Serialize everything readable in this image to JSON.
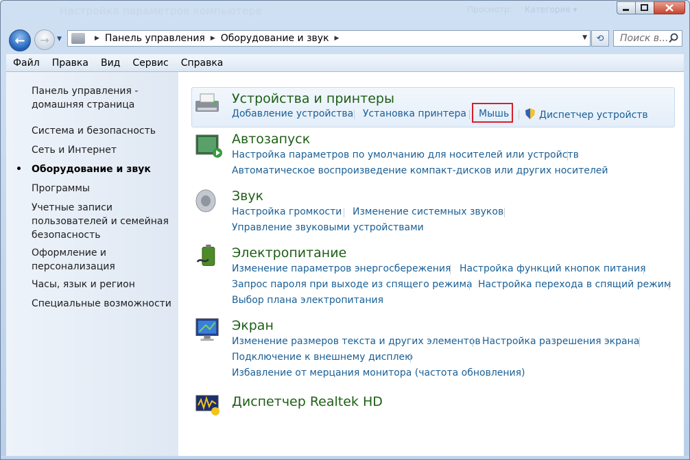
{
  "window": {
    "title": "Настройка параметров компьютера",
    "title_right_1": "Просмотр:",
    "title_right_2": "Категория ▾",
    "minimize_icon": "minimize-icon",
    "maximize_icon": "maximize-icon",
    "close_icon": "close-icon"
  },
  "nav": {
    "back_glyph": "←",
    "forward_glyph": "→",
    "breadcrumb": [
      "Панель управления",
      "Оборудование и звук"
    ],
    "search_placeholder": "Поиск в...",
    "refresh_glyph": "⟲",
    "search_glyph": "⌕"
  },
  "menu": [
    "Файл",
    "Правка",
    "Вид",
    "Сервис",
    "Справка"
  ],
  "sidebar": {
    "home_line1": "Панель управления -",
    "home_line2": "домашняя страница",
    "items": [
      "Система и безопасность",
      "Сеть и Интернет",
      "Оборудование и звук",
      "Программы",
      "Учетные записи",
      "пользователей и семейная",
      "безопасность",
      "Оформление и",
      "персонализация",
      "Часы, язык и регион",
      "Специальные возможности"
    ]
  },
  "sections": {
    "devices": {
      "title": "Устройства и принтеры",
      "links": [
        "Добавление устройства",
        "Установка принтера",
        "Мышь",
        "Диспетчер устройств"
      ]
    },
    "autoplay": {
      "title": "Автозапуск",
      "links": [
        "Настройка параметров по умолчанию для носителей или устройств",
        "Автоматическое воспроизведение компакт-дисков или других носителей"
      ]
    },
    "sound": {
      "title": "Звук",
      "links": [
        "Настройка громкости",
        "Изменение системных звуков",
        "Управление звуковыми устройствами"
      ]
    },
    "power": {
      "title": "Электропитание",
      "links": [
        "Изменение параметров энергосбережения",
        "Настройка функций кнопок питания",
        "Запрос пароля при выходе из спящего режима",
        "Настройка перехода в спящий режим",
        "Выбор плана электропитания"
      ]
    },
    "display": {
      "title": "Экран",
      "links": [
        "Изменение размеров текста и других элементов",
        "Настройка разрешения экрана",
        "Подключение к внешнему дисплею",
        "Избавление от мерцания монитора (частота обновления)"
      ]
    },
    "realtek": {
      "title": "Диспетчер Realtek HD"
    }
  },
  "colors": {
    "section_title": "#1e5e16",
    "link": "#1a5f95",
    "highlight_box": "#d3202a"
  }
}
